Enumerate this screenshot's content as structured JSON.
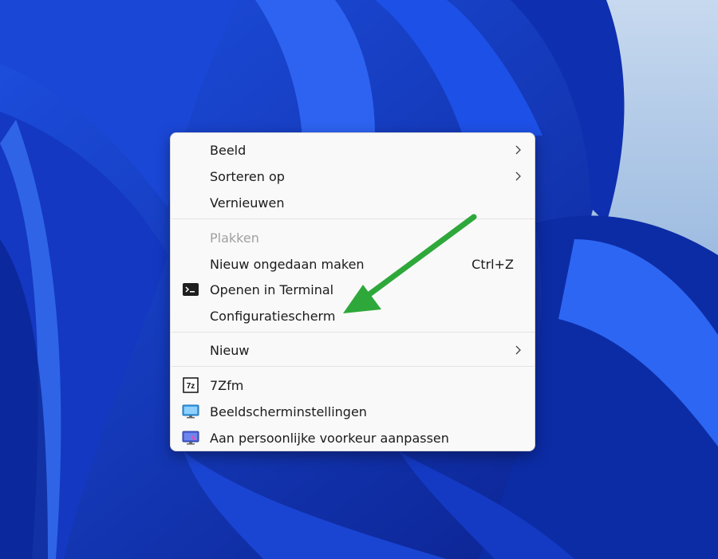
{
  "context_menu": {
    "items": [
      {
        "label": "Beeld",
        "submenu": true,
        "icon": null,
        "disabled": false
      },
      {
        "label": "Sorteren op",
        "submenu": true,
        "icon": null,
        "disabled": false
      },
      {
        "label": "Vernieuwen",
        "submenu": false,
        "icon": null,
        "disabled": false
      },
      {
        "label": "Plakken",
        "submenu": false,
        "icon": null,
        "disabled": true
      },
      {
        "label": "Nieuw ongedaan maken",
        "shortcut": "Ctrl+Z",
        "submenu": false,
        "icon": null,
        "disabled": false
      },
      {
        "label": "Openen in Terminal",
        "submenu": false,
        "icon": "terminal-icon",
        "disabled": false
      },
      {
        "label": "Configuratiescherm",
        "submenu": false,
        "icon": null,
        "disabled": false
      },
      {
        "label": "Nieuw",
        "submenu": true,
        "icon": null,
        "disabled": false
      },
      {
        "label": "7Zfm",
        "submenu": false,
        "icon": "7zip-icon",
        "disabled": false
      },
      {
        "label": "Beeldscherminstellingen",
        "submenu": false,
        "icon": "display-settings-icon",
        "disabled": false
      },
      {
        "label": "Aan persoonlijke voorkeur aanpassen",
        "submenu": false,
        "icon": "personalize-icon",
        "disabled": false
      }
    ]
  },
  "annotation": {
    "arrow_color": "#2ea83a",
    "arrow_target": "Configuratiescherm"
  },
  "colors": {
    "wallpaper_blue": "#0a2fa8",
    "menu_background": "#f9f9f9",
    "text": "#1b1b1b",
    "disabled_text": "#a0a0a0"
  }
}
